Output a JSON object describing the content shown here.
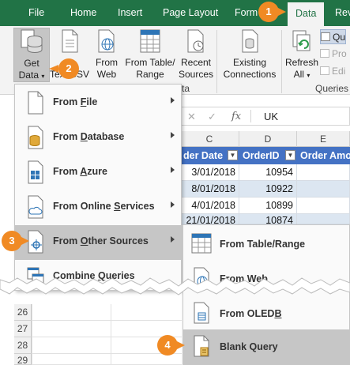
{
  "tabs": [
    {
      "label": "File"
    },
    {
      "label": "Home"
    },
    {
      "label": "Insert"
    },
    {
      "label": "Page Layout"
    },
    {
      "label": "Form"
    },
    {
      "label": "Data"
    },
    {
      "label": "Rev"
    }
  ],
  "ribbon": {
    "get_data": {
      "line1": "Get",
      "line2": "Data"
    },
    "from_text": {
      "line1": "m",
      "line2": "Text/CSV"
    },
    "from_web": {
      "line1": "From",
      "line2": "Web"
    },
    "from_table": {
      "line1": "From Table/",
      "line2": "Range"
    },
    "recent_sources": {
      "line1": "Recent",
      "line2": "Sources"
    },
    "existing_connections": {
      "line1": "Existing",
      "line2": "Connections"
    },
    "refresh_all": {
      "line1": "Refresh",
      "line2": "All"
    },
    "group_get_transform_tail": "ta",
    "group_queries_label": "Queries a",
    "small_queries": "Qu",
    "small_properties": "Pro",
    "small_edit_links": "Edi"
  },
  "formula_bar": {
    "fx_symbol": "fx",
    "value": "UK"
  },
  "columns": [
    "C",
    "D",
    "E"
  ],
  "table_headers": [
    "der Date",
    "OrderID",
    "Order Amo"
  ],
  "table_rows": [
    {
      "date": "3/01/2018",
      "order_id": "10954"
    },
    {
      "date": "8/01/2018",
      "order_id": "10922"
    },
    {
      "date": "4/01/2018",
      "order_id": "10899"
    },
    {
      "date": "21/01/2018",
      "order_id": "10874"
    }
  ],
  "row_numbers": [
    "26",
    "27",
    "28",
    "29"
  ],
  "get_data_menu": [
    {
      "label": "From File",
      "underline": "F"
    },
    {
      "label": "From Database",
      "underline": "D"
    },
    {
      "label": "From Azure",
      "underline": "A"
    },
    {
      "label": "From Online Services",
      "underline": "S"
    },
    {
      "label": "From Other Sources",
      "underline": "O"
    },
    {
      "label": "Combine Queries",
      "underline": "Q"
    }
  ],
  "other_sources_menu": [
    {
      "label": "From Table/Range"
    },
    {
      "label": "From Web"
    },
    {
      "label": "From OLEDB"
    },
    {
      "label": "Blank Query"
    }
  ],
  "callouts": [
    "1",
    "2",
    "3",
    "4"
  ],
  "colors": {
    "ribbon_green": "#217346",
    "callout_orange": "#f08a24",
    "table_header_blue": "#4472c4",
    "table_band": "#dce6f1",
    "menu_highlight": "#c6c6c6"
  }
}
